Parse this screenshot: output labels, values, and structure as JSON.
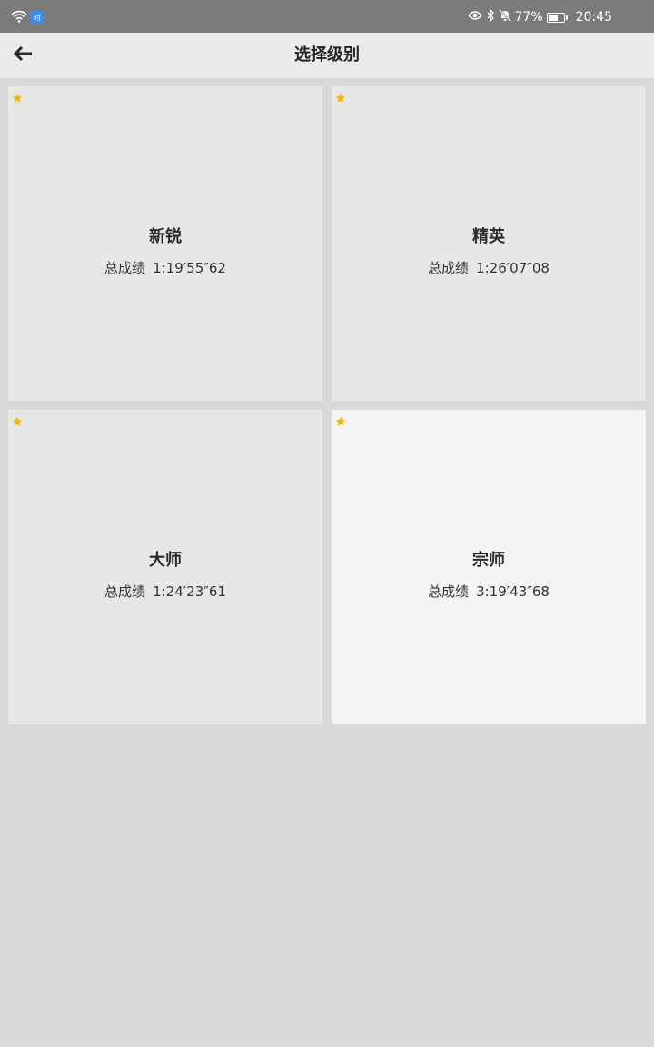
{
  "status_bar": {
    "app_badge_text": "时",
    "battery_percent": "77%",
    "battery_level": 0.77,
    "time": "20:45",
    "icons": [
      "wifi-icon",
      "app-notification-icon",
      "eye-icon",
      "bluetooth-icon",
      "mute-icon",
      "battery-icon"
    ]
  },
  "header": {
    "title": "选择级别",
    "back_icon": "arrow-left-icon"
  },
  "levels": [
    {
      "name": "新锐",
      "score_label": "总成绩",
      "score": "1:19′55″62",
      "star_color": "#f2b705",
      "highlighted": false
    },
    {
      "name": "精英",
      "score_label": "总成绩",
      "score": "1:26′07″08",
      "star_color": "#f2b705",
      "highlighted": false
    },
    {
      "name": "大师",
      "score_label": "总成绩",
      "score": "1:24′23″61",
      "star_color": "#f2b705",
      "highlighted": false
    },
    {
      "name": "宗师",
      "score_label": "总成绩",
      "score": "3:19′43″68",
      "star_color": "#f2b705",
      "highlighted": true
    }
  ],
  "colors": {
    "status_bar_bg": "#7b7b7b",
    "header_bg": "#ebebea",
    "page_bg": "#d9d9d8",
    "card_bg": "#e7e7e6",
    "card_highlight_bg": "#f4f4f2",
    "star": "#f2b705"
  }
}
